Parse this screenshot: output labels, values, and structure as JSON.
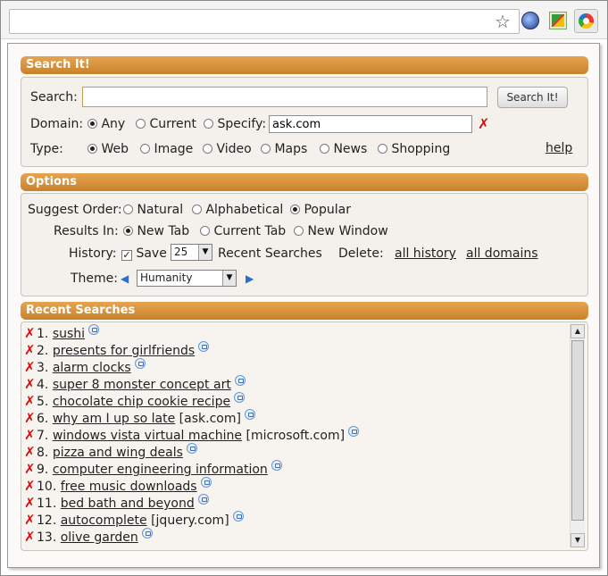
{
  "browser": {
    "star_glyph": "☆"
  },
  "search_section": {
    "header": "Search It!",
    "search_label": "Search:",
    "search_value": "",
    "search_button": "Search It!",
    "domain_label": "Domain:",
    "domain_options": [
      "Any",
      "Current",
      "Specify:"
    ],
    "domain_selected": "Any",
    "specify_value": "ask.com",
    "type_label": "Type:",
    "type_options": [
      "Web",
      "Image",
      "Video",
      "Maps",
      "News",
      "Shopping"
    ],
    "type_selected": "Web",
    "help_link": "help"
  },
  "options_section": {
    "header": "Options",
    "suggest_label": "Suggest Order:",
    "suggest_options": [
      "Natural",
      "Alphabetical",
      "Popular"
    ],
    "suggest_selected": "Popular",
    "results_label": "Results In:",
    "results_options": [
      "New Tab",
      "Current Tab",
      "New Window"
    ],
    "results_selected": "New Tab",
    "history_label": "History:",
    "save_label": "Save",
    "save_checked": true,
    "save_count": "25",
    "recent_searches_label": "Recent Searches",
    "delete_label": "Delete:",
    "all_history_link": "all history",
    "all_domains_link": "all domains",
    "theme_label": "Theme:",
    "theme_value": "Humanity"
  },
  "recent_section": {
    "header": "Recent Searches",
    "items": [
      {
        "num": "1.",
        "text": "sushi",
        "domain": ""
      },
      {
        "num": "2.",
        "text": "presents for girlfriends",
        "domain": ""
      },
      {
        "num": "3.",
        "text": "alarm clocks",
        "domain": ""
      },
      {
        "num": "4.",
        "text": "super 8 monster concept art",
        "domain": ""
      },
      {
        "num": "5.",
        "text": "chocolate chip cookie recipe",
        "domain": ""
      },
      {
        "num": "6.",
        "text": "why am I up so late",
        "domain": "[ask.com]"
      },
      {
        "num": "7.",
        "text": "windows vista virtual machine",
        "domain": "[microsoft.com]"
      },
      {
        "num": "8.",
        "text": "pizza and wing deals",
        "domain": ""
      },
      {
        "num": "9.",
        "text": "computer engineering information",
        "domain": ""
      },
      {
        "num": "10.",
        "text": "free music downloads",
        "domain": ""
      },
      {
        "num": "11.",
        "text": "bed bath and beyond",
        "domain": ""
      },
      {
        "num": "12.",
        "text": "autocomplete",
        "domain": "[jquery.com]"
      },
      {
        "num": "13.",
        "text": "olive garden",
        "domain": ""
      }
    ]
  },
  "colors": {
    "header_orange": "#d68f38",
    "delete_red": "#d01010",
    "arrow_blue": "#2a6fc9"
  }
}
